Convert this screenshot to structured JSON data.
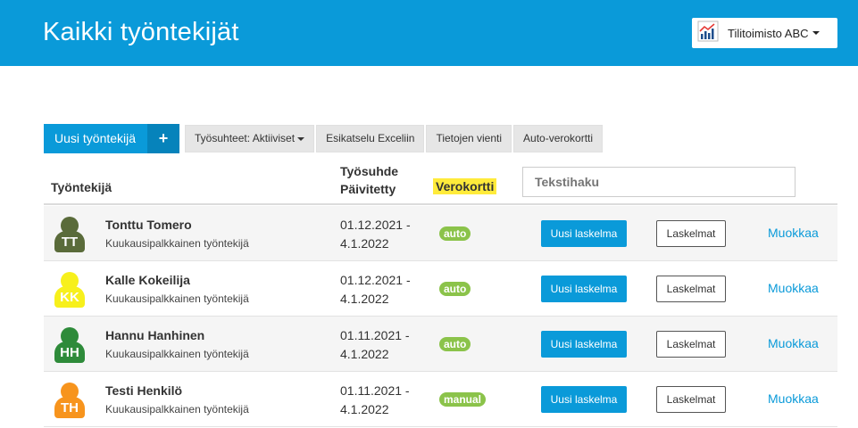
{
  "header": {
    "title": "Kaikki työntekijät",
    "company": "Tilitoimisto ABC",
    "company_icon": "chart-logo-icon"
  },
  "toolbar": {
    "new_employee": "Uusi työntekijä",
    "plus": "+",
    "employments_filter": "Työsuhteet: Aktiiviset",
    "preview_excel": "Esikatselu Exceliin",
    "data_export": "Tietojen vienti",
    "auto_taxcard": "Auto-verokortti"
  },
  "table": {
    "col_employee": "Työntekijä",
    "col_employment_line1": "Työsuhde",
    "col_employment_line2": "Päivitetty",
    "col_taxcard": "Verokortti",
    "search_placeholder": "Tekstihaku",
    "rows": [
      {
        "initials": "TT",
        "name": "Tonttu Tomero",
        "type": "Kuukausipalkkainen työntekijä",
        "date1": "01.12.2021 -",
        "date2": "4.1.2022",
        "taxcard": "auto",
        "calc": "Uusi laskelma",
        "list": "Laskelmat",
        "edit": "Muokkaa",
        "avatar_color": "#5a6b3a"
      },
      {
        "initials": "KK",
        "name": "Kalle Kokeilija",
        "type": "Kuukausipalkkainen työntekijä",
        "date1": "01.12.2021 -",
        "date2": "4.1.2022",
        "taxcard": "auto",
        "calc": "Uusi laskelma",
        "list": "Laskelmat",
        "edit": "Muokkaa",
        "avatar_color": "#f7f01c"
      },
      {
        "initials": "HH",
        "name": "Hannu Hanhinen",
        "type": "Kuukausipalkkainen työntekijä",
        "date1": "01.11.2021 -",
        "date2": "4.1.2022",
        "taxcard": "auto",
        "calc": "Uusi laskelma",
        "list": "Laskelmat",
        "edit": "Muokkaa",
        "avatar_color": "#2e8b3a"
      },
      {
        "initials": "TH",
        "name": "Testi Henkilö",
        "type": "Kuukausipalkkainen työntekijä",
        "date1": "01.11.2021 -",
        "date2": "4.1.2022",
        "taxcard": "manual",
        "calc": "Uusi laskelma",
        "list": "Laskelmat",
        "edit": "Muokkaa",
        "avatar_color": "#f7941d"
      }
    ]
  }
}
